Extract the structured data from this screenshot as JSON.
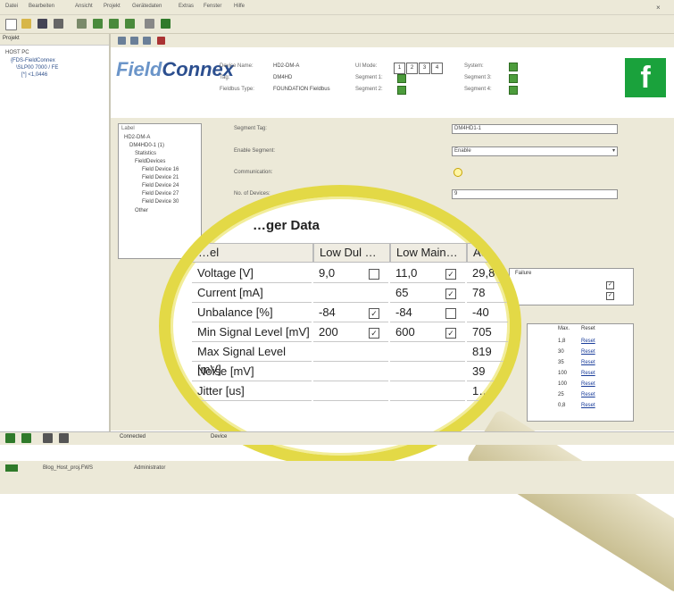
{
  "menu": [
    "Datei",
    "Bearbeiten",
    "Ansicht",
    "Projekt",
    "Gerätedaten",
    "Extras",
    "Fenster",
    "Hilfe"
  ],
  "left_panel": {
    "title": "Projekt",
    "tree": [
      "HOST PC",
      "{FDS-FieldConnex",
      "\\SLP00 7000 / FE",
      "[*] <1,0446"
    ]
  },
  "header": {
    "brand_a": "Field",
    "brand_b": "Connex",
    "device_name_label": "Device Name:",
    "device_name": "HD2-DM-A",
    "tag_label": "Tag:",
    "tag": "DM4HD",
    "fieldbus_label": "Fieldbus Type:",
    "fieldbus": "FOUNDATION Fieldbus",
    "ui_mode_label": "UI Mode:",
    "ui_buttons": [
      "1",
      "2",
      "3",
      "4"
    ],
    "seg1": "Segment 1:",
    "seg2": "Segment 2:",
    "system": "System:",
    "seg3": "Segment 3:",
    "seg4": "Segment 4:",
    "brand_logo": "f"
  },
  "tree_box": {
    "title": "Label",
    "items": [
      "HD2-DM-A",
      "DM4HD0-1 (1)",
      "Statistics",
      "FieldDevices",
      "Field Device 16",
      "Field Device 21",
      "Field Device 24",
      "Field Device 27",
      "Field Device 30",
      "Other"
    ]
  },
  "form": {
    "segment_tag_label": "Segment Tag:",
    "segment_tag_value": "DM4HD1-1",
    "enable_label": "Enable Segment:",
    "enable_value": "Enable",
    "communication_label": "Communication:",
    "num_devices_label": "No. of Devices:",
    "num_devices_value": "9"
  },
  "magnified": {
    "title": "…ger Data",
    "columns": [
      "…el",
      "Low Dul …",
      "Low Main…",
      "Ac…"
    ],
    "rows": [
      {
        "label": "Voltage [V]",
        "low_dul": "9,0",
        "low_dul_chk": false,
        "low_main": "11,0",
        "low_main_chk": true,
        "actual": "29,8"
      },
      {
        "label": "Current [mA]",
        "low_dul": "",
        "low_dul_chk": null,
        "low_main": "65",
        "low_main_chk": true,
        "actual": "78"
      },
      {
        "label": "Unbalance [%]",
        "low_dul": "-84",
        "low_dul_chk": true,
        "low_main": "-84",
        "low_main_chk": false,
        "actual": "-40"
      },
      {
        "label": "Min Signal Level [mV]",
        "low_dul": "200",
        "low_dul_chk": true,
        "low_main": "600",
        "low_main_chk": true,
        "actual": "705"
      },
      {
        "label": "Max Signal Level [mV]",
        "low_dul": "",
        "low_dul_chk": null,
        "low_main": "",
        "low_main_chk": null,
        "actual": "819"
      },
      {
        "label": "Noise [mV]",
        "low_dul": "",
        "low_dul_chk": null,
        "low_main": "",
        "low_main_chk": null,
        "actual": "39"
      },
      {
        "label": "Jitter [us]",
        "low_dul": "",
        "low_dul_chk": null,
        "low_main": "",
        "low_main_chk": null,
        "actual": "1…"
      }
    ]
  },
  "right_table": {
    "headers": [
      "Failure"
    ],
    "col_b": [
      "Max.",
      "Reset"
    ],
    "values": [
      "1,8",
      "30",
      "35",
      "100",
      "100",
      "25",
      "0,8"
    ],
    "reset_label": "Reset"
  },
  "bottom": {
    "connected": "Connected",
    "device": "Device",
    "status1": "Blog_Host_proj.FWS",
    "status2": "Administrator"
  },
  "colors": {
    "accent": "#e3d946",
    "brand_green": "#1aa23c",
    "led": "#4c9c3c"
  }
}
